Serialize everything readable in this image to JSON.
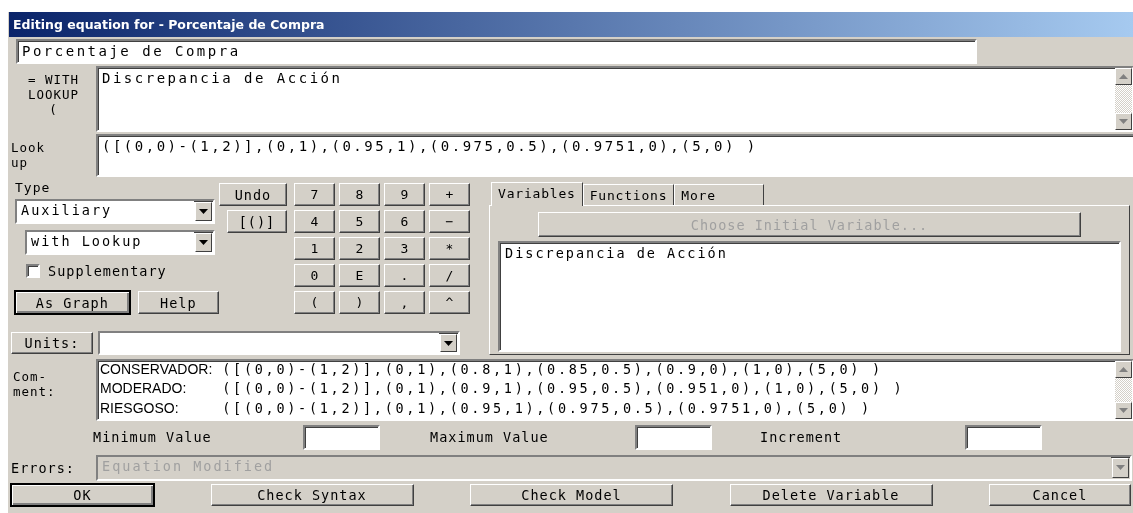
{
  "window": {
    "title": "Editing equation for - Porcentaje de Compra"
  },
  "variable_name": {
    "value": "Porcentaje de Compra"
  },
  "equation": {
    "label_lines": [
      "= WITH",
      "LOOKUP",
      "("
    ],
    "value": "Discrepancia de Acción"
  },
  "lookup": {
    "label_lines": [
      "Look",
      "up"
    ],
    "value": "([(0,0)-(1,2)],(0,1),(0.95,1),(0.975,0.5),(0.9751,0),(5,0) )"
  },
  "type": {
    "label": "Type",
    "value": "Auxiliary"
  },
  "subtype": {
    "value": "with Lookup"
  },
  "supplementary": {
    "label": "Supplementary",
    "checked": false
  },
  "undo_button": {
    "label": "Undo"
  },
  "bracket_button": {
    "label": "[()]"
  },
  "keypad": [
    "7",
    "4",
    "1",
    "0",
    "(",
    "8",
    "5",
    "2",
    "E",
    ")",
    "9",
    "6",
    "3",
    ".",
    ",",
    "+",
    "−",
    "*",
    "/",
    "^"
  ],
  "left_buttons": [
    {
      "label": "As Graph",
      "default": true
    },
    {
      "label": "Help",
      "default": false
    }
  ],
  "tabs": [
    {
      "label": "Variables",
      "selected": true
    },
    {
      "label": "Functions",
      "selected": false
    },
    {
      "label": "More",
      "selected": false
    }
  ],
  "choose_button": {
    "label": "Choose Initial Variable...",
    "disabled": true
  },
  "variables_list": [
    "Discrepancia de Acción"
  ],
  "units": {
    "label": "Units:"
  },
  "comment": {
    "label_lines": [
      "Com-",
      "ment:"
    ],
    "lines": [
      {
        "label": "CONSERVADOR:",
        "formula": "([(0,0)-(1,2)],(0,1),(0.8,1),(0.85,0.5),(0.9,0),(1,0),(5,0) )"
      },
      {
        "label": "MODERADO:",
        "formula": "([(0,0)-(1,2)],(0,1),(0.9,1),(0.95,0.5),(0.951,0),(1,0),(5,0) )"
      },
      {
        "label": "RIESGOSO:",
        "formula": "([(0,0)-(1,2)],(0,1),(0.95,1),(0.975,0.5),(0.9751,0),(5,0) )"
      }
    ]
  },
  "range": [
    {
      "label": "Minimum Value"
    },
    {
      "label": "Maximum Value"
    },
    {
      "label": "Increment"
    }
  ],
  "errors": {
    "label": "Errors:",
    "value": "Equation Modified",
    "disabled": true
  },
  "buttons": [
    {
      "label": "OK",
      "default": true
    },
    {
      "label": "Check Syntax",
      "default": false
    },
    {
      "label": "Check Model",
      "default": false
    },
    {
      "label": "Delete Variable",
      "default": false
    },
    {
      "label": "Cancel",
      "default": false
    }
  ]
}
